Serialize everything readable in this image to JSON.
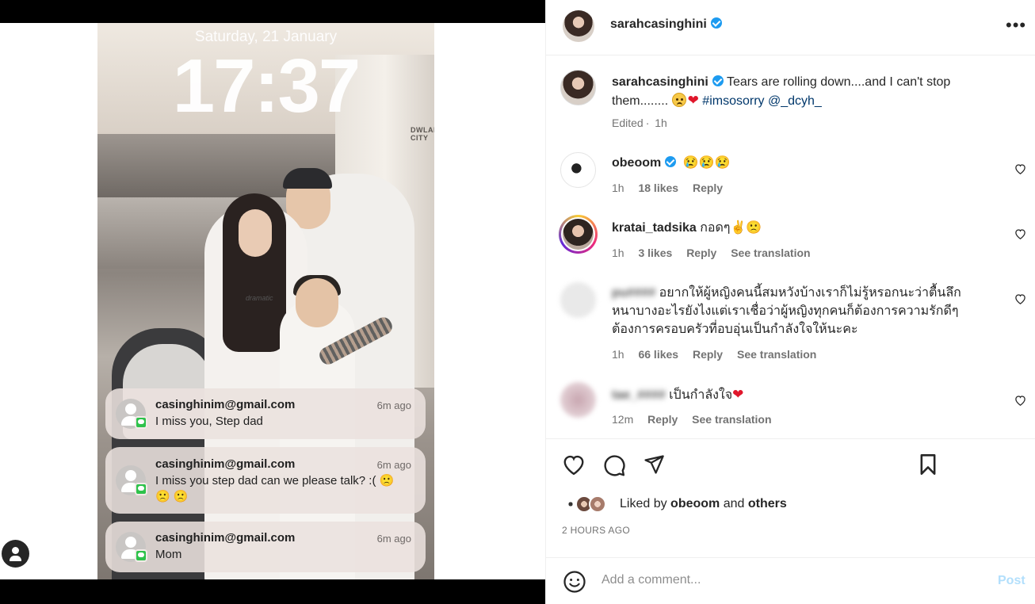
{
  "lockscreen": {
    "date": "Saturday, 21 January",
    "time": "17:37",
    "mall_sign": "DWLAI CITY",
    "shirt_text": "dramatic",
    "notifications": [
      {
        "from": "casinghinim@gmail.com",
        "message": "I miss you, Step dad",
        "time": "6m ago"
      },
      {
        "from": "casinghinim@gmail.com",
        "message": "I miss you step dad can we please talk? :( 🙁 🙁 🙁",
        "time": "6m ago"
      },
      {
        "from": "casinghinim@gmail.com",
        "message": "Mom",
        "time": "6m ago"
      }
    ]
  },
  "header": {
    "username": "sarahcasinghini",
    "more_icon": "•••"
  },
  "caption": {
    "username": "sarahcasinghini",
    "text": "Tears are rolling down....and I can't stop them........",
    "hashtag": "#imsosorry",
    "mention": "@_dcyh_",
    "edited": "Edited",
    "time": "1h"
  },
  "comments": [
    {
      "username": "obeoom",
      "verified": true,
      "text": "😢😢😢",
      "time": "1h",
      "likes": "18 likes",
      "reply": "Reply"
    },
    {
      "username": "kratai_tadsika",
      "text": "กอดๆ✌🙁",
      "time": "1h",
      "likes": "3 likes",
      "reply": "Reply",
      "translate": "See translation"
    },
    {
      "username": "pu####",
      "text": "อยากให้ผู้หญิงคนนี้สมหวังบ้างเราก็ไม่รู้หรอกนะว่าตื้นลึกหนาบางอะไรยังไงแต่เราเชื่อว่าผู้หญิงทุกคนก็ต้องการความรักดีๆ ต้องการครอบครัวที่อบอุ่นเป็นกำลังใจให้นะคะ",
      "time": "1h",
      "likes": "66 likes",
      "reply": "Reply",
      "translate": "See translation"
    },
    {
      "username": "tae_####",
      "text": "เป็นกำลังใจ",
      "time": "12m",
      "reply": "Reply",
      "translate": "See translation"
    }
  ],
  "likes": {
    "prefix": "Liked by",
    "user": "obeoom",
    "and": "and",
    "others": "others"
  },
  "timestamp": "2 HOURS AGO",
  "add_comment": {
    "placeholder": "Add a comment...",
    "post": "Post"
  },
  "colors": {
    "link": "#00376b",
    "verified": "#1d9bf0",
    "post_disabled": "#b2dffc"
  }
}
